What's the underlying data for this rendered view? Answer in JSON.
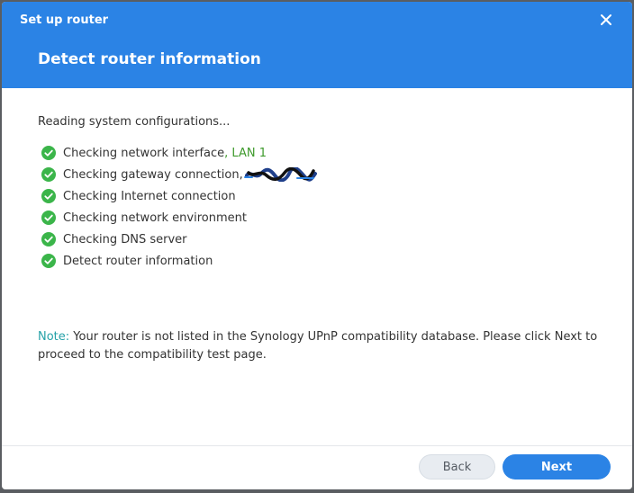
{
  "window": {
    "title": "Set up router"
  },
  "step": {
    "title": "Detect router information"
  },
  "status": {
    "reading": "Reading system configurations..."
  },
  "checks": [
    {
      "label": "Checking network interface",
      "detail": ", LAN 1"
    },
    {
      "label": "Checking gateway connection, ",
      "detail": ""
    },
    {
      "label": "Checking Internet connection",
      "detail": ""
    },
    {
      "label": "Checking network environment",
      "detail": ""
    },
    {
      "label": "Checking DNS server",
      "detail": ""
    },
    {
      "label": "Detect router information",
      "detail": ""
    }
  ],
  "note": {
    "label": "Note:",
    "text": " Your router is not listed in the Synology UPnP compatibility database. Please click Next to proceed to the compatibility test page."
  },
  "buttons": {
    "back": "Back",
    "next": "Next"
  },
  "icons": {
    "close": "close-icon",
    "check": "check-circle-icon"
  },
  "colors": {
    "header": "#2b83e5",
    "success": "#3e9a2c",
    "note_label": "#27a2a8",
    "primary_button": "#2b83e5"
  }
}
